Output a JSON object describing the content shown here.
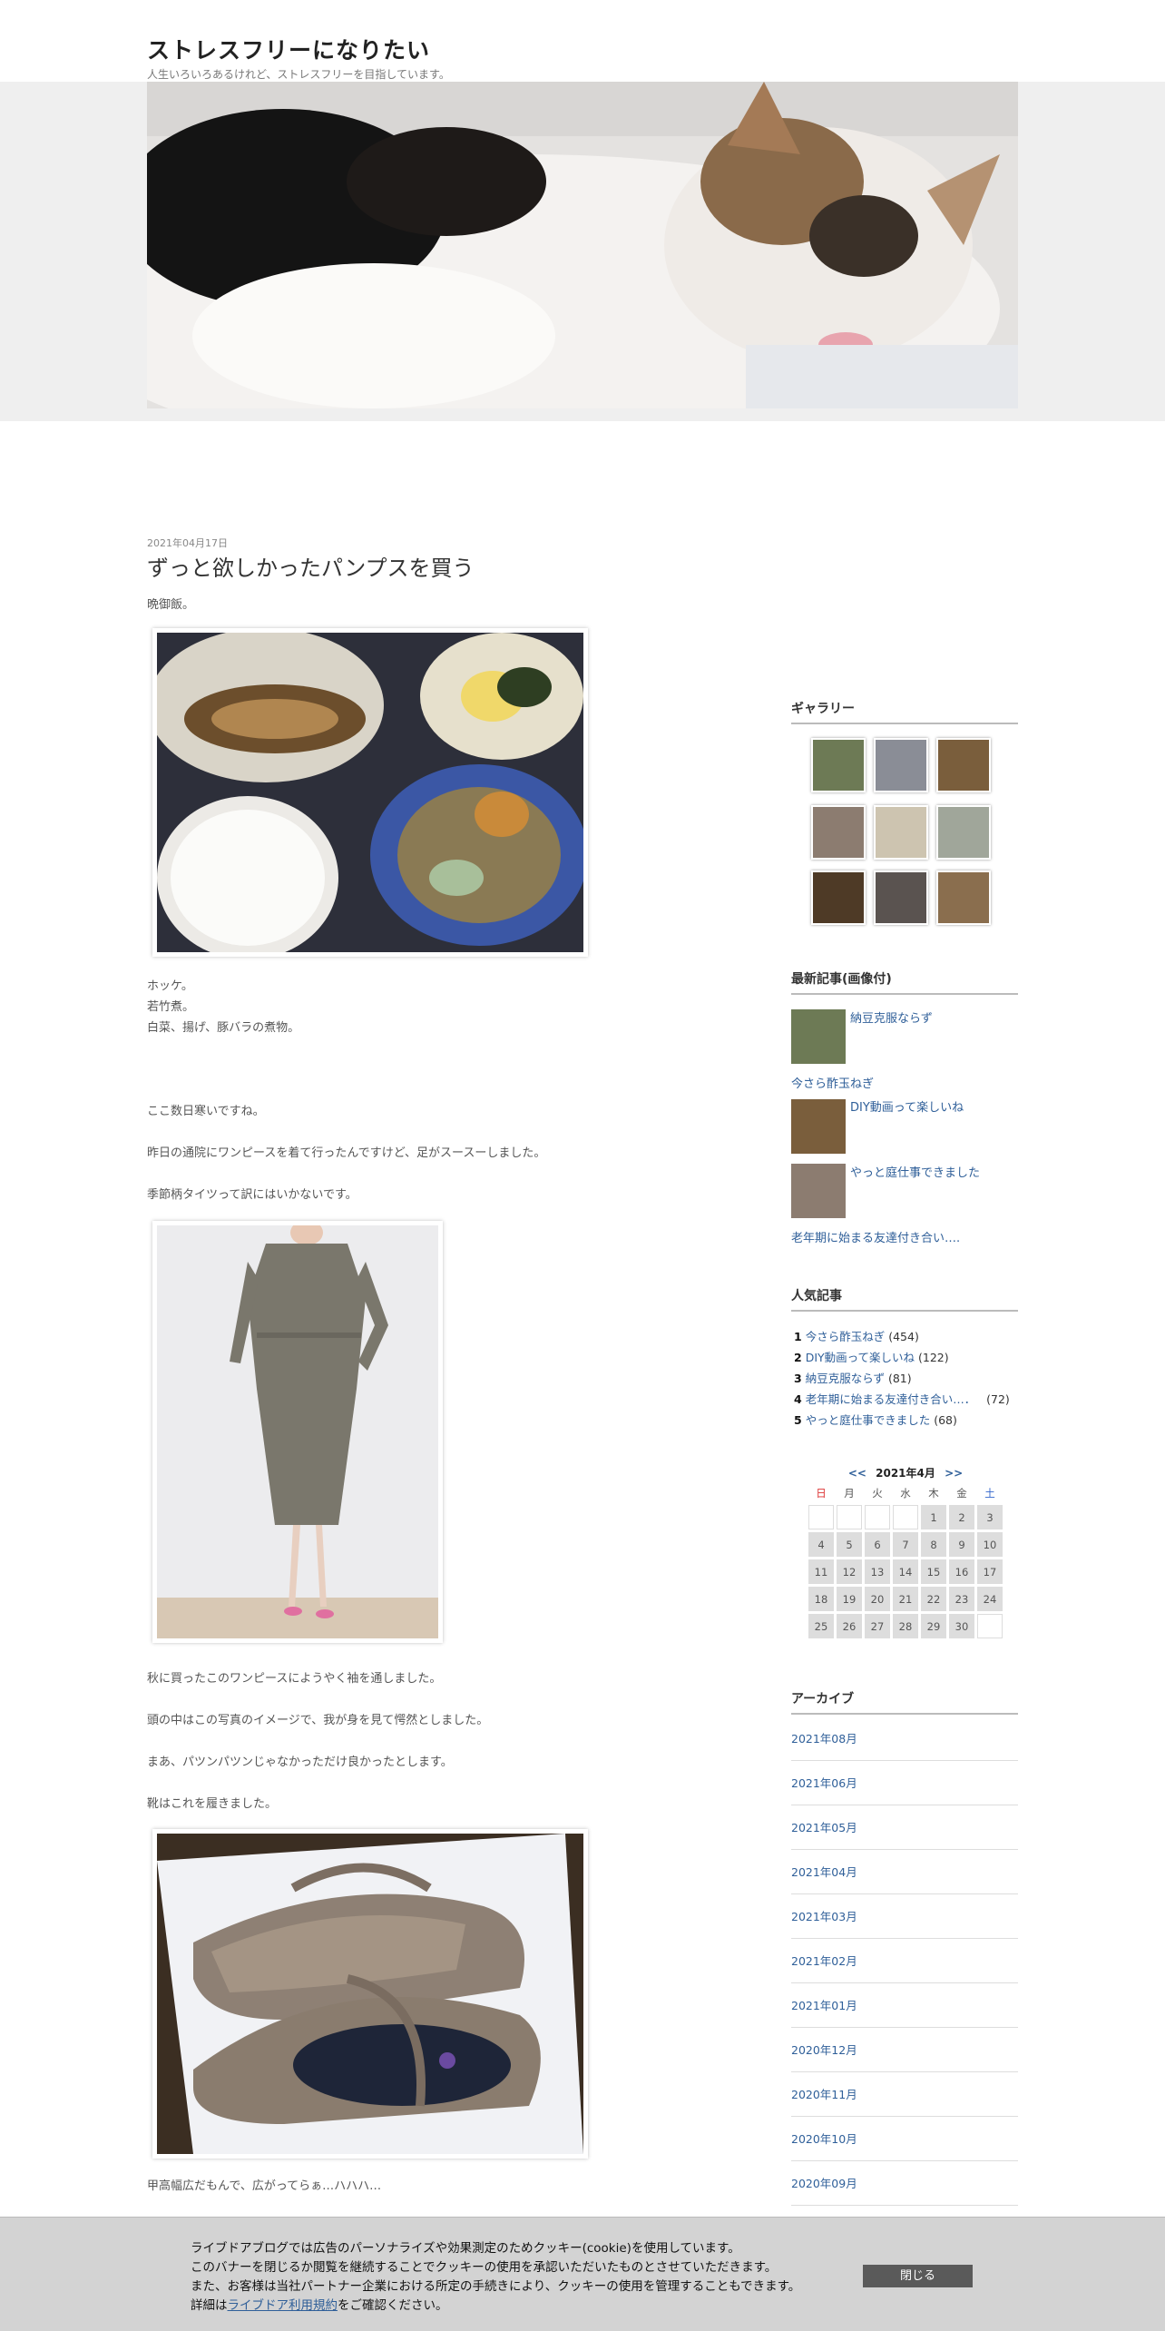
{
  "site": {
    "title": "ストレスフリーになりたい",
    "description": "人生いろいろあるけれど、ストレスフリーを目指しています。"
  },
  "post": {
    "date": "2021年04月17日",
    "title": "ずっと欲しかったパンプスを買う",
    "p1": "晩御飯。",
    "p2": "ホッケ。",
    "p3": "若竹煮。",
    "p4": "白菜、揚げ、豚バラの煮物。",
    "p5": "ここ数日寒いですね。",
    "p6": "昨日の通院にワンピースを着て行ったんですけど、足がスースーしました。",
    "p7": "季節柄タイツって訳にはいかないです。",
    "p8": "秋に買ったこのワンピースにようやく袖を通しました。",
    "p9": "頭の中はこの写真のイメージで、我が身を見て愕然としました。",
    "p10": "まあ、パツンパツンじゃなかっただけ良かったとします。",
    "p11": "靴はこれを履きました。",
    "p12": "甲高幅広だもんで、広がってらぁ…ハハハ…"
  },
  "sidebar": {
    "gallery_heading": "ギャラリー",
    "latest_heading": "最新記事(画像付)",
    "latest": [
      {
        "label": "納豆克服ならず"
      },
      {
        "label": "今さら酢玉ねぎ"
      },
      {
        "label": "DIY動画って楽しいね"
      },
      {
        "label": "やっと庭仕事できました"
      },
      {
        "label": "老年期に始まる友達付き合い…."
      }
    ],
    "popular_heading": "人気記事",
    "popular": [
      {
        "rank": "1",
        "label": "今さら酢玉ねぎ",
        "count": "(454)"
      },
      {
        "rank": "2",
        "label": "DIY動画って楽しいね",
        "count": "(122)"
      },
      {
        "rank": "3",
        "label": "納豆克服ならず",
        "count": "(81)"
      },
      {
        "rank": "4",
        "label": "老年期に始まる友達付き合い…．",
        "count": "(72)"
      },
      {
        "rank": "5",
        "label": "やっと庭仕事できました",
        "count": "(68)"
      }
    ],
    "calendar": {
      "prev": "<<",
      "title": "2021年4月",
      "next": ">>",
      "weekdays": [
        "日",
        "月",
        "火",
        "水",
        "木",
        "金",
        "土"
      ],
      "days": [
        "",
        "",
        "",
        "",
        "1",
        "2",
        "3",
        "4",
        "5",
        "6",
        "7",
        "8",
        "9",
        "10",
        "11",
        "12",
        "13",
        "14",
        "15",
        "16",
        "17",
        "18",
        "19",
        "20",
        "21",
        "22",
        "23",
        "24",
        "25",
        "26",
        "27",
        "28",
        "29",
        "30",
        ""
      ]
    },
    "archive_heading": "アーカイブ",
    "archive": [
      "2021年08月",
      "2021年06月",
      "2021年05月",
      "2021年04月",
      "2021年03月",
      "2021年02月",
      "2021年01月",
      "2020年12月",
      "2020年11月",
      "2020年10月",
      "2020年09月"
    ]
  },
  "cookie": {
    "line1": "ライブドアブログでは広告のパーソナライズや効果測定のためクッキー(cookie)を使用しています。",
    "line2": "このバナーを閉じるか閲覧を継続することでクッキーの使用を承認いただいたものとさせていただきます。",
    "line3": "また、お客様は当社パートナー企業における所定の手続きにより、クッキーの使用を管理することもできます。",
    "line4_prefix": "詳細は",
    "line4_link": "ライブドア利用規約",
    "line4_suffix": "をご確認ください。",
    "close_label": "閉じる"
  },
  "colors": {
    "link": "#2f5f99",
    "banner_bg": "#d3d3d3",
    "close_button": "#5a5a5a"
  }
}
